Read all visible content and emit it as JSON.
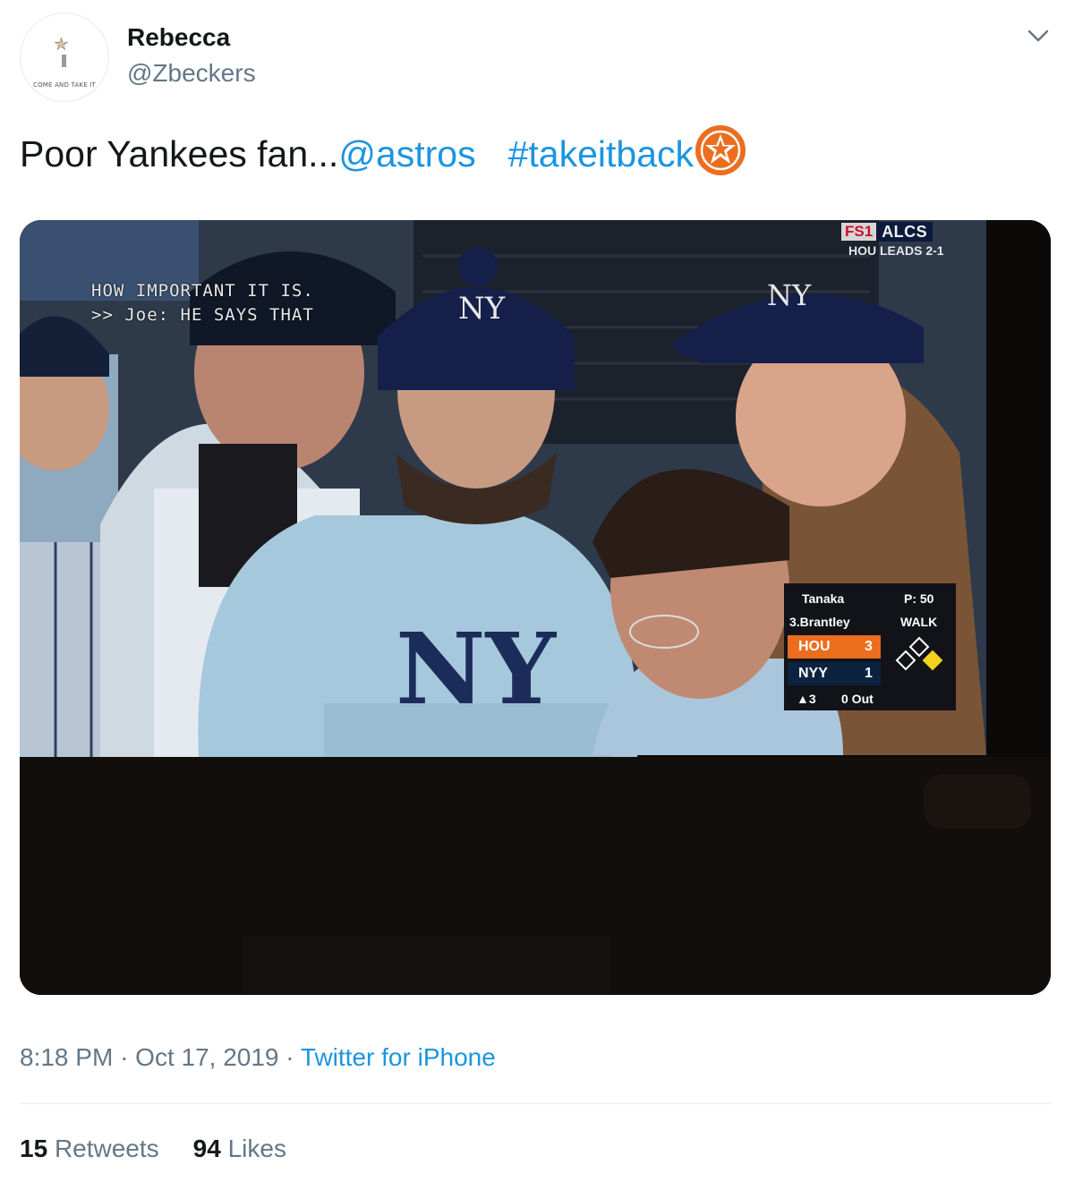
{
  "author": {
    "name": "Rebecca",
    "handle": "@Zbeckers",
    "avatar_caption": "COME AND TAKE IT"
  },
  "tweet": {
    "text_prefix": "Poor Yankees fan...",
    "mention": "@astros",
    "hashtag": "#takeitback",
    "emoji": "astros-star-emoji"
  },
  "broadcast": {
    "closed_caption_line1": "HOW IMPORTANT IT IS.",
    "closed_caption_line2": ">> Joe: HE SAYS THAT",
    "network": "FS1",
    "series": "ALCS",
    "series_status": "HOU LEADS 2-1",
    "scorebug": {
      "pitcher": "Tanaka",
      "pitch_count": "P: 50",
      "batter": "3.Brantley",
      "play": "WALK",
      "teams": [
        {
          "abbr": "HOU",
          "score": "3",
          "color": "#eb6e1f"
        },
        {
          "abbr": "NYY",
          "score": "1",
          "color": "#0c2340"
        }
      ],
      "inning": "▲3",
      "outs": "0 Out"
    }
  },
  "meta": {
    "time": "8:18 PM",
    "date": "Oct 17, 2019",
    "separator": "·",
    "source": "Twitter for iPhone"
  },
  "stats": {
    "retweets": "15",
    "retweets_label": "Retweets",
    "likes": "94",
    "likes_label": "Likes"
  },
  "colors": {
    "link": "#1b95e0",
    "secondary_text": "#657786",
    "primary_text": "#14171a",
    "astros_orange": "#eb6e1f",
    "yankees_navy": "#0c2340"
  }
}
